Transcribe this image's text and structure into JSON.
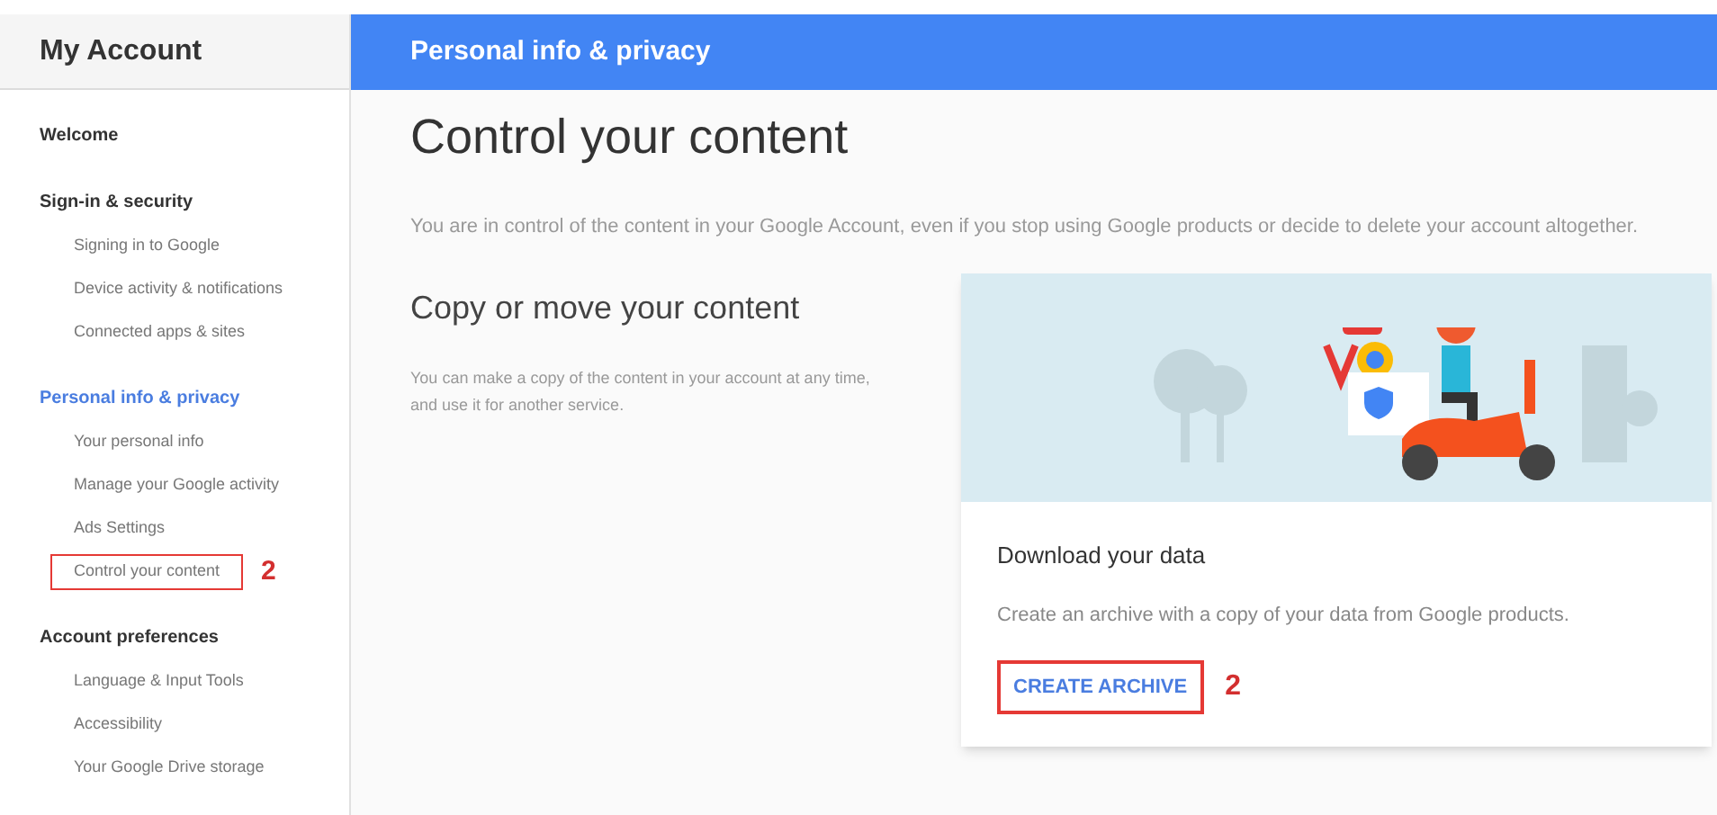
{
  "sidebar": {
    "title": "My Account",
    "sections": [
      {
        "label": "Welcome",
        "selected": false
      },
      {
        "label": "Sign-in & security",
        "selected": false,
        "items": [
          {
            "label": "Signing in to Google",
            "highlighted": false
          },
          {
            "label": "Device activity & notifications",
            "highlighted": false
          },
          {
            "label": "Connected apps & sites",
            "highlighted": false
          }
        ]
      },
      {
        "label": "Personal info & privacy",
        "selected": true,
        "items": [
          {
            "label": "Your personal info",
            "highlighted": false
          },
          {
            "label": "Manage your Google activity",
            "highlighted": false
          },
          {
            "label": "Ads Settings",
            "highlighted": false
          },
          {
            "label": "Control your content",
            "highlighted": true,
            "annotation": "2"
          }
        ]
      },
      {
        "label": "Account preferences",
        "selected": false,
        "items": [
          {
            "label": "Language & Input Tools",
            "highlighted": false
          },
          {
            "label": "Accessibility",
            "highlighted": false
          },
          {
            "label": "Your Google Drive storage",
            "highlighted": false
          }
        ]
      }
    ]
  },
  "header": {
    "title": "Personal info & privacy"
  },
  "main": {
    "title": "Control your content",
    "intro": "You are in control of the content in your Google Account, even if you stop using Google products or decide to delete your account altogether.",
    "section": {
      "title": "Copy or move your content",
      "description": "You can make a copy of the content in your account at any time, and use it for another service."
    },
    "card": {
      "title": "Download your data",
      "description": "Create an archive with a copy of your data from Google products.",
      "button": {
        "label": "CREATE ARCHIVE",
        "highlighted": true,
        "annotation": "2"
      }
    }
  }
}
